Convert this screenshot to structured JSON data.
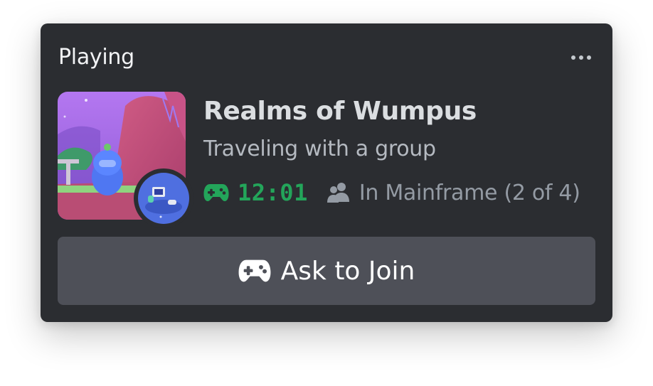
{
  "activity": {
    "header": "Playing",
    "game_title": "Realms of Wumpus",
    "state": "Traveling with a group",
    "elapsed": "12:01",
    "party": "In Mainframe (2 of 4)",
    "join_label": "Ask to Join"
  },
  "icons": {
    "menu": "more-horizontal-icon",
    "timer": "gamepad-icon",
    "party": "people-icon",
    "join": "gamepad-icon"
  },
  "colors": {
    "card_bg": "#2b2d31",
    "timer_green": "#23a55a",
    "button_bg": "#4e5058",
    "muted_text": "#949ba4"
  }
}
